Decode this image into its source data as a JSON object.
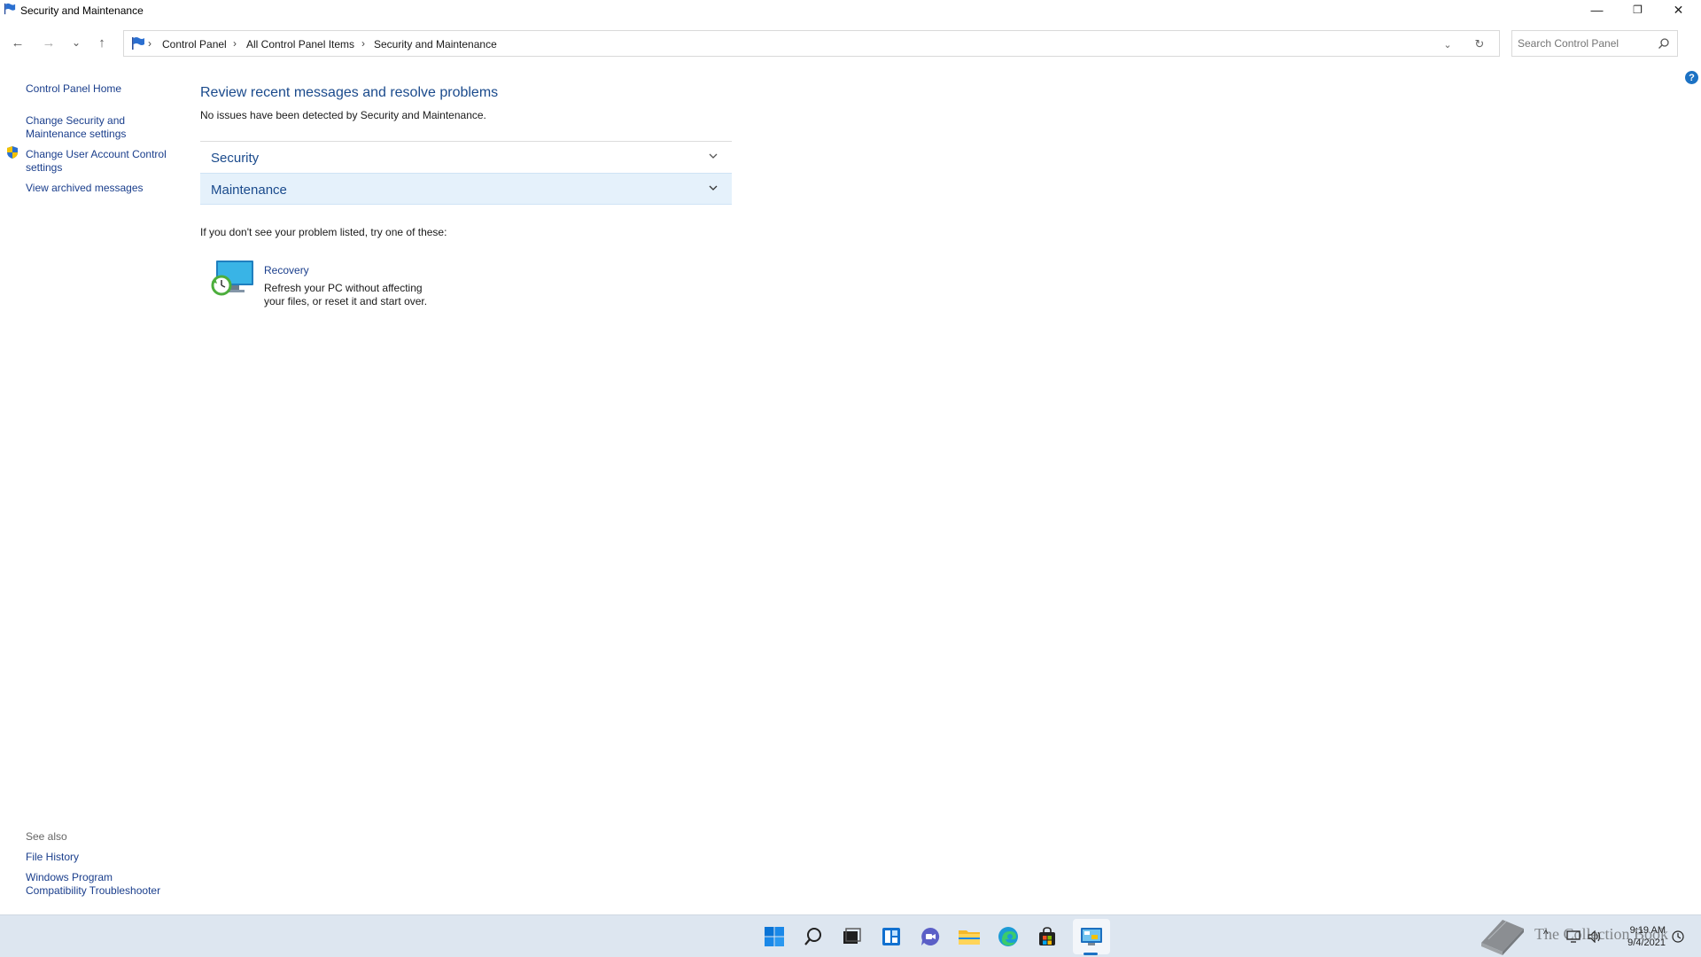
{
  "window": {
    "title": "Security and Maintenance",
    "minimize_label": "—",
    "restore_label": "❐",
    "close_label": "✕"
  },
  "nav": {
    "back_label": "←",
    "forward_label": "→",
    "recent_label": "⌄",
    "up_label": "↑"
  },
  "address": {
    "crumbs": [
      "Control Panel",
      "All Control Panel Items",
      "Security and Maintenance"
    ],
    "separator": "›",
    "dropdown_label": "⌄",
    "refresh_label": "↻"
  },
  "search": {
    "placeholder": "Search Control Panel",
    "value": ""
  },
  "help": {
    "label": "?"
  },
  "sidebar": {
    "home": "Control Panel Home",
    "items": [
      {
        "label": "Change Security and Maintenance settings",
        "icon": ""
      },
      {
        "label": "Change User Account Control settings",
        "icon": "uac-shield-icon"
      },
      {
        "label": "View archived messages",
        "icon": ""
      }
    ],
    "see_also_title": "See also",
    "see_also": [
      "File History",
      "Windows Program Compatibility Troubleshooter"
    ]
  },
  "main": {
    "heading": "Review recent messages and resolve problems",
    "subtext": "No issues have been detected by Security and Maintenance.",
    "sections": [
      {
        "title": "Security",
        "highlighted": false
      },
      {
        "title": "Maintenance",
        "highlighted": true
      }
    ],
    "try_line": "If you don't see your problem listed, try one of these:",
    "recovery": {
      "title": "Recovery",
      "description": "Refresh your PC without affecting your files, or reset it and start over."
    }
  },
  "taskbar": {
    "icons": [
      "start-icon",
      "search-icon",
      "task-view-icon",
      "widgets-icon",
      "chat-icon",
      "file-explorer-icon",
      "edge-icon",
      "store-icon",
      "control-panel-icon"
    ],
    "time": "9:19 AM",
    "date": "9/4/2021",
    "tray_chevron": "^",
    "watermark_text": "The Collection Book"
  },
  "colors": {
    "accent": "#1c72c4",
    "link": "#1a3e8c",
    "heading": "#1a4a8c",
    "section_highlight": "#e5f1fb",
    "taskbar": "#dde6f0"
  }
}
